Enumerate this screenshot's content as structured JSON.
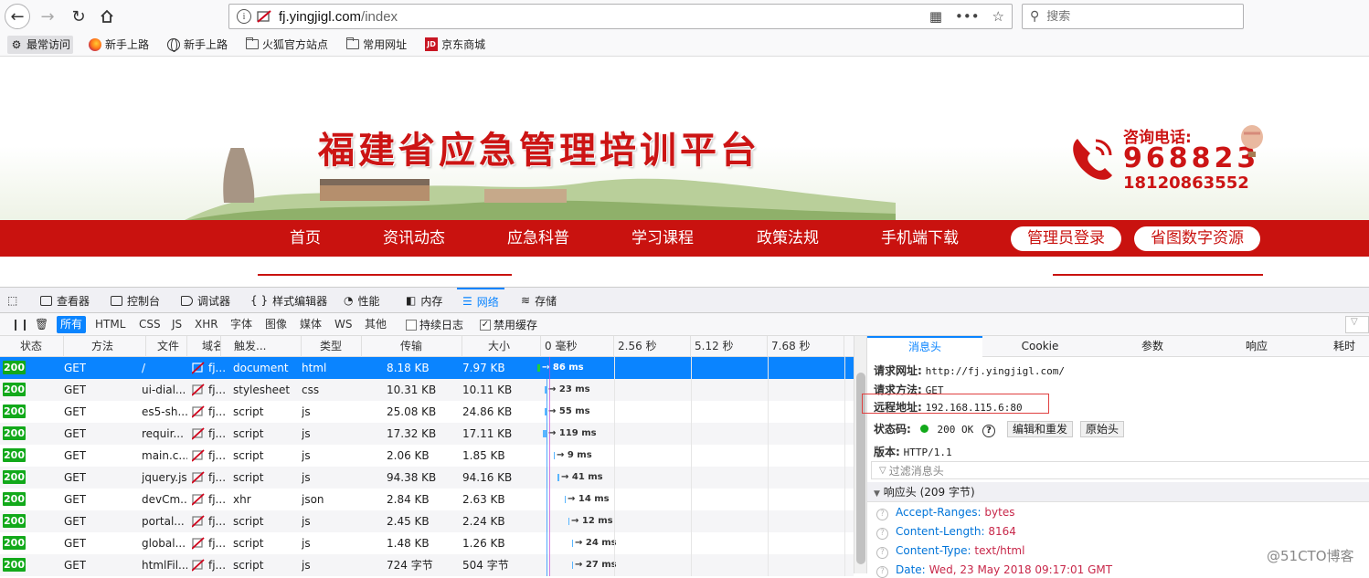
{
  "browser": {
    "url_host": "fj.yingjigl.com",
    "url_path": "/index",
    "search_placeholder": "搜索"
  },
  "bookmarks": [
    {
      "label": "最常访问",
      "icon": "gear-icon"
    },
    {
      "label": "新手上路",
      "icon": "firefox-icon"
    },
    {
      "label": "新手上路",
      "icon": "globe-icon"
    },
    {
      "label": "火狐官方站点",
      "icon": "folder-icon"
    },
    {
      "label": "常用网址",
      "icon": "folder-icon"
    },
    {
      "label": "京东商城",
      "icon": "jd-icon"
    }
  ],
  "page": {
    "title": "福建省应急管理培训平台",
    "consult_label": "咨询电话:",
    "hotline": "968823",
    "mobile": "18120863552",
    "nav": [
      "首页",
      "资讯动态",
      "应急科普",
      "学习课程",
      "政策法规",
      "手机端下载"
    ],
    "nav_buttons": [
      "管理员登录",
      "省图数字资源"
    ],
    "colors": {
      "brand_red": "#c9120f"
    }
  },
  "devtools": {
    "tabs": [
      "查看器",
      "控制台",
      "调试器",
      "样式编辑器",
      "性能",
      "内存",
      "网络",
      "存储"
    ],
    "selected_tab": "网络",
    "filters": [
      "所有",
      "HTML",
      "CSS",
      "JS",
      "XHR",
      "字体",
      "图像",
      "媒体",
      "WS",
      "其他"
    ],
    "persist_log": "持续日志",
    "disable_cache": "禁用缓存",
    "columns": [
      "状态",
      "方法",
      "文件",
      "域名",
      "触发...",
      "类型",
      "传输",
      "大小"
    ],
    "timeline_ticks": [
      "0 毫秒",
      "2.56 秒",
      "5.12 秒",
      "7.68 秒"
    ],
    "requests": [
      {
        "status": "200",
        "method": "GET",
        "file": "/",
        "domain": "fj....",
        "cause": "document",
        "type": "html",
        "transferred": "8.18 KB",
        "size": "7.97 KB",
        "time": "→ 86 ms"
      },
      {
        "status": "200",
        "method": "GET",
        "file": "ui-dial...",
        "domain": "fj....",
        "cause": "stylesheet",
        "type": "css",
        "transferred": "10.31 KB",
        "size": "10.11 KB",
        "time": "→ 23 ms"
      },
      {
        "status": "200",
        "method": "GET",
        "file": "es5-sh...",
        "domain": "fj....",
        "cause": "script",
        "type": "js",
        "transferred": "25.08 KB",
        "size": "24.86 KB",
        "time": "→ 55 ms"
      },
      {
        "status": "200",
        "method": "GET",
        "file": "requir...",
        "domain": "fj....",
        "cause": "script",
        "type": "js",
        "transferred": "17.32 KB",
        "size": "17.11 KB",
        "time": "→ 119 ms"
      },
      {
        "status": "200",
        "method": "GET",
        "file": "main.c...",
        "domain": "fj....",
        "cause": "script",
        "type": "js",
        "transferred": "2.06 KB",
        "size": "1.85 KB",
        "time": "→ 9 ms"
      },
      {
        "status": "200",
        "method": "GET",
        "file": "jquery.js",
        "domain": "fj....",
        "cause": "script",
        "type": "js",
        "transferred": "94.38 KB",
        "size": "94.16 KB",
        "time": "→ 41 ms"
      },
      {
        "status": "200",
        "method": "GET",
        "file": "devCm...",
        "domain": "fj....",
        "cause": "xhr",
        "type": "json",
        "transferred": "2.84 KB",
        "size": "2.63 KB",
        "time": "→ 14 ms"
      },
      {
        "status": "200",
        "method": "GET",
        "file": "portal...",
        "domain": "fj....",
        "cause": "script",
        "type": "js",
        "transferred": "2.45 KB",
        "size": "2.24 KB",
        "time": "→ 12 ms"
      },
      {
        "status": "200",
        "method": "GET",
        "file": "global...",
        "domain": "fj....",
        "cause": "script",
        "type": "js",
        "transferred": "1.48 KB",
        "size": "1.26 KB",
        "time": "→ 24 ms"
      },
      {
        "status": "200",
        "method": "GET",
        "file": "htmlFil...",
        "domain": "fj....",
        "cause": "script",
        "type": "js",
        "transferred": "724 字节",
        "size": "504 字节",
        "time": "→ 27 ms"
      }
    ],
    "details": {
      "tabs": [
        "消息头",
        "Cookie",
        "参数",
        "响应",
        "耗时"
      ],
      "request_url_label": "请求网址:",
      "request_url": "http://fj.yingjigl.com/",
      "method_label": "请求方法:",
      "method": "GET",
      "remote_label": "远程地址:",
      "remote": "192.168.115.6:80",
      "status_label": "状态码:",
      "status": "200 OK",
      "edit_resend": "编辑和重发",
      "raw_headers": "原始头",
      "version_label": "版本:",
      "version": "HTTP/1.1",
      "filter_placeholder": "过滤消息头",
      "response_headers": "响应头 (209 字节)",
      "headers": [
        {
          "key": "Accept-Ranges:",
          "value": "bytes"
        },
        {
          "key": "Content-Length:",
          "value": "8164"
        },
        {
          "key": "Content-Type:",
          "value": "text/html"
        },
        {
          "key": "Date:",
          "value": "Wed, 23 May 2018 09:17:01 GMT"
        }
      ]
    }
  },
  "watermark": "@51CTO博客"
}
